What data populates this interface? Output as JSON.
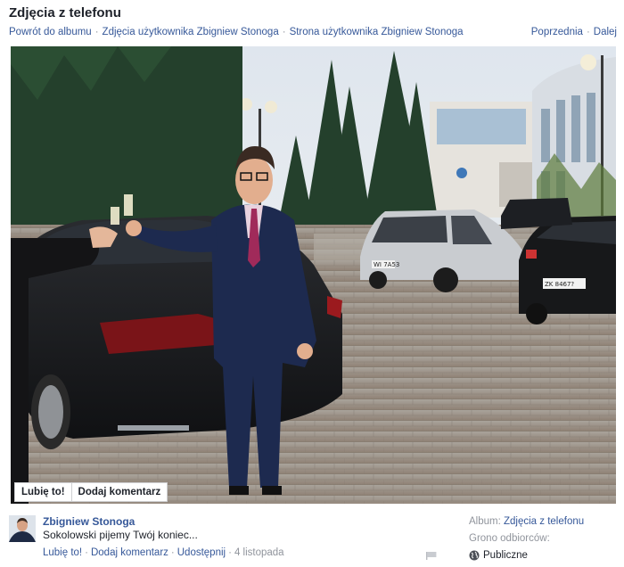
{
  "page": {
    "title": "Zdjęcia z telefonu"
  },
  "breadcrumb": {
    "back": "Powrót do albumu",
    "user_photos": "Zdjęcia użytkownika Zbigniew Stonoga",
    "user_page": "Strona użytkownika Zbigniew Stonoga",
    "separator": "·"
  },
  "pager": {
    "prev": "Poprzednia",
    "next": "Dalej",
    "separator": "·"
  },
  "photo_actions": {
    "like": "Lubię to!",
    "comment": "Dodaj komentarz"
  },
  "plates": {
    "left": "WI 7A53",
    "right": "ZK 8467?"
  },
  "post": {
    "author": "Zbigniew Stonoga",
    "caption": "Sokolowski pijemy Twój koniec...",
    "actions": [
      "Lubię to!",
      "Dodaj komentarz",
      "Udostępnij"
    ],
    "date": "4 listopada",
    "separator": "·"
  },
  "sidebar": {
    "album_label": "Album:",
    "album_value": "Zdjęcia z telefonu",
    "audience_label": "Grono odbiorców:",
    "audience_value": "Publiczne"
  },
  "colors": {
    "link": "#365899",
    "muted": "#90949c",
    "text": "#1d2129"
  },
  "icons": {
    "globe": "globe-icon",
    "flag": "flag-icon"
  }
}
